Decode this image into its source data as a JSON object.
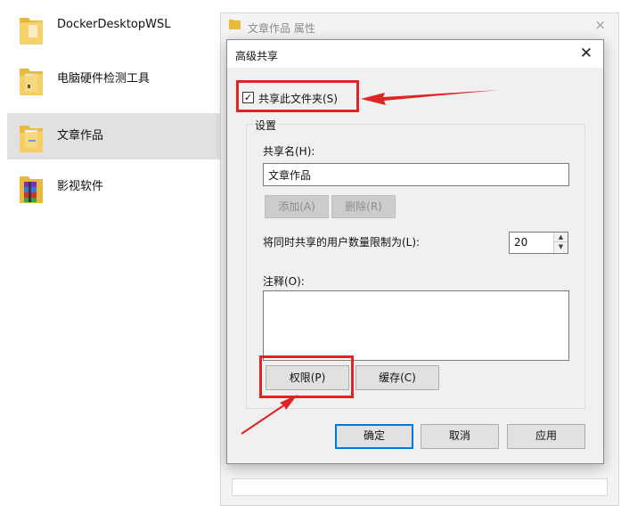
{
  "files": [
    {
      "name": "DockerDesktopWSL",
      "selected": false,
      "icon": "folder-icon"
    },
    {
      "name": "电脑硬件检测工具",
      "selected": false,
      "icon": "folder-with-document-icon"
    },
    {
      "name": "文章作品",
      "selected": true,
      "icon": "folder-with-document-icon"
    },
    {
      "name": "影视软件",
      "selected": false,
      "icon": "folder-with-archive-icon"
    }
  ],
  "properties_window": {
    "title": "文章作品 属性",
    "close": "×"
  },
  "dialog": {
    "title": "高级共享",
    "close": "✕",
    "share_checkbox": {
      "label": "共享此文件夹(S)",
      "checked": true,
      "mark": "✓"
    },
    "settings_group": "设置",
    "share_name_label": "共享名(H):",
    "share_name_value": "文章作品",
    "add_button": "添加(A)",
    "remove_button": "删除(R)",
    "user_limit_label": "将同时共享的用户数量限制为(L):",
    "user_limit_value": "20",
    "spin_up": "▲",
    "spin_down": "▼",
    "comment_label": "注释(O):",
    "comment_value": "",
    "permissions_button": "权限(P)",
    "caching_button": "缓存(C)",
    "ok_button": "确定",
    "cancel_button": "取消",
    "apply_button": "应用"
  },
  "colors": {
    "highlight": "#e02424",
    "accent": "#0078d7",
    "folder": "#f2c94c"
  }
}
